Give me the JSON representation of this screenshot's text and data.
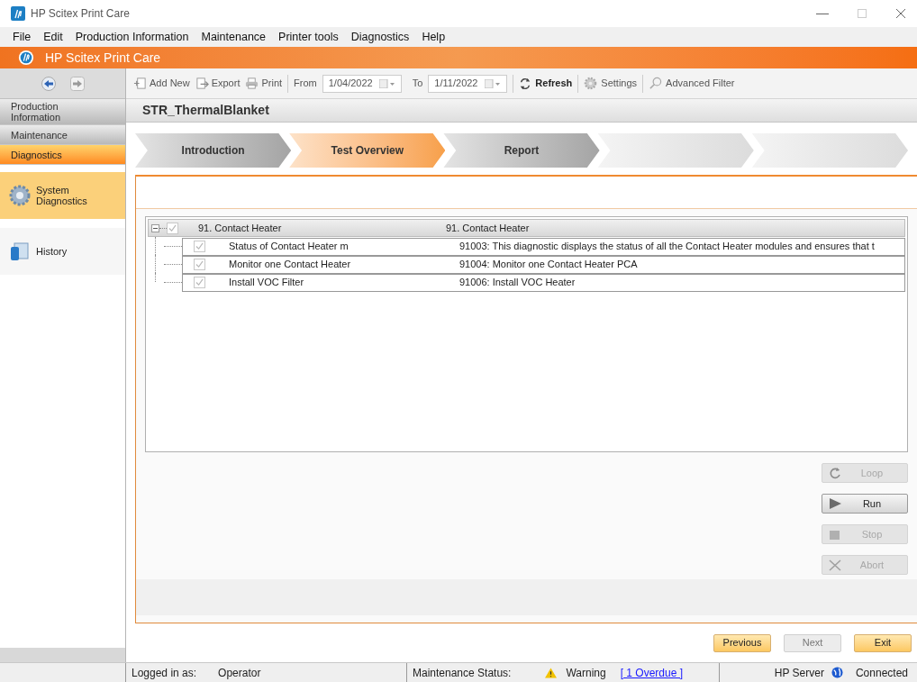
{
  "window": {
    "title": "HP Scitex Print Care"
  },
  "menu": [
    "File",
    "Edit",
    "Production Information",
    "Maintenance",
    "Printer tools",
    "Diagnostics",
    "Help"
  ],
  "banner": {
    "title": "HP Scitex Print Care"
  },
  "sidebar": {
    "sections": [
      {
        "label": "Production Information",
        "selected": false
      },
      {
        "label": "Maintenance",
        "selected": false
      },
      {
        "label": "Diagnostics",
        "selected": true
      }
    ],
    "items": [
      {
        "label": "System Diagnostics",
        "selected": true,
        "kind": "gear"
      },
      {
        "label": "History",
        "selected": false,
        "kind": "history"
      }
    ]
  },
  "toolbar": {
    "add_new": "Add New",
    "export": "Export",
    "print": "Print",
    "from_label": "From",
    "from_value": "1/04/2022",
    "to_label": "To",
    "to_value": "1/11/2022",
    "refresh": "Refresh",
    "settings": "Settings",
    "advanced_filter": "Advanced Filter"
  },
  "page_title": "STR_ThermalBlanket",
  "steps": [
    {
      "label": "Introduction",
      "selected": false
    },
    {
      "label": "Test Overview",
      "selected": true
    },
    {
      "label": "Report",
      "selected": false
    }
  ],
  "tree": {
    "expanded": true,
    "checked": true,
    "name": "91. Contact Heater",
    "description": "91. Contact Heater",
    "children": [
      {
        "name": "Status of Contact Heater m",
        "description": "91003: This diagnostic displays the status of all the Contact Heater modules and ensures that t",
        "checked": true
      },
      {
        "name": "Monitor one Contact Heater",
        "description": "91004: Monitor one Contact Heater PCA",
        "checked": true
      },
      {
        "name": "Install VOC Filter",
        "description": "91006: Install VOC Heater",
        "checked": true
      }
    ]
  },
  "actions": [
    {
      "label": "Loop",
      "kind": "loop",
      "disabled": true
    },
    {
      "label": "Run",
      "kind": "run",
      "disabled": false
    },
    {
      "label": "Stop",
      "kind": "stop",
      "disabled": true
    },
    {
      "label": "Abort",
      "kind": "abort",
      "disabled": true
    }
  ],
  "nav_buttons": [
    {
      "label": "Previous",
      "disabled": false
    },
    {
      "label": "Next",
      "disabled": true
    },
    {
      "label": "Exit",
      "disabled": false
    }
  ],
  "status_bar": {
    "logged_in_label": "Logged in as:",
    "user": "Operator",
    "maintenance_label": "Maintenance Status:",
    "maintenance_value": "Warning",
    "overdue_link": "[ 1 Overdue ]",
    "server": "HP Server",
    "connection": "Connected"
  }
}
